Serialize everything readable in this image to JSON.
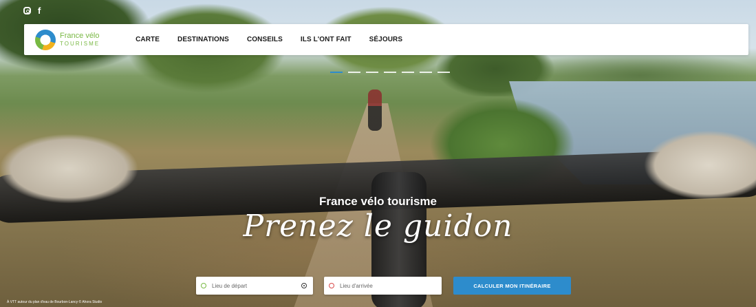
{
  "social": {
    "instagram_icon": "instagram-icon",
    "facebook_icon": "facebook-icon"
  },
  "logo": {
    "line1_part1": "France",
    "line1_part2": "vélo",
    "line2": "TOURISME"
  },
  "nav": {
    "items": [
      "CARTE",
      "DESTINATIONS",
      "CONSEILS",
      "ILS L'ONT FAIT",
      "SÉJOURS"
    ]
  },
  "slider": {
    "count": 7,
    "active_index": 0
  },
  "hero": {
    "headline": "France vélo tourisme",
    "tagline": "Prenez le guidon"
  },
  "search": {
    "start_placeholder": "Lieu de départ",
    "end_placeholder": "Lieu d'arrivée",
    "submit_label": "CALCULER MON ITINÉRAIRE"
  },
  "photo_credit": "À VTT autour du plan d'eau de Bourbon-Lancy © Ahora Studio",
  "colors": {
    "brand_blue": "#2d8ccc",
    "brand_green": "#78b943",
    "end_ring": "#d94b4b"
  }
}
